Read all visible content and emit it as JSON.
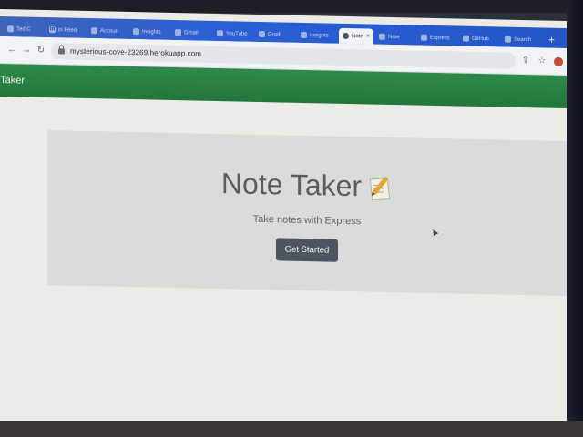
{
  "browser": {
    "tabs": [
      {
        "label": "Ted C",
        "icon": "tab-favicon",
        "active": false
      },
      {
        "label": "in Feed",
        "icon": "linkedin-icon",
        "active": false
      },
      {
        "label": "Accoun",
        "icon": "tab-favicon",
        "active": false
      },
      {
        "label": "Insights",
        "icon": "tab-favicon",
        "active": false
      },
      {
        "label": "Gmail",
        "icon": "tab-favicon",
        "active": false
      },
      {
        "label": "YouTube",
        "icon": "tab-favicon",
        "active": false
      },
      {
        "label": "Gradi",
        "icon": "tab-favicon",
        "active": false
      },
      {
        "label": "Insights",
        "icon": "tab-favicon",
        "active": false
      },
      {
        "label": "Note",
        "icon": "globe-icon",
        "active": true
      },
      {
        "label": "Note",
        "icon": "tab-favicon",
        "active": false
      },
      {
        "label": "Express",
        "icon": "tab-favicon",
        "active": false
      },
      {
        "label": "GitHub",
        "icon": "tab-favicon",
        "active": false
      },
      {
        "label": "Search",
        "icon": "tab-favicon",
        "active": false
      },
      {
        "label": "Insights",
        "icon": "tab-favicon",
        "active": false
      }
    ],
    "active_tab_close": "×",
    "new_tab": "+",
    "url": "mysterious-cove-23269.herokuapp.com"
  },
  "app": {
    "brand": "Note Taker"
  },
  "hero": {
    "title": "Note Taker",
    "subtitle": "Take notes with Express",
    "button_label": "Get Started"
  },
  "colors": {
    "navbar": "#23763c",
    "jumbotron": "#d9dcda",
    "button": "#4d565f",
    "tabbar": "#2a5fd6"
  }
}
